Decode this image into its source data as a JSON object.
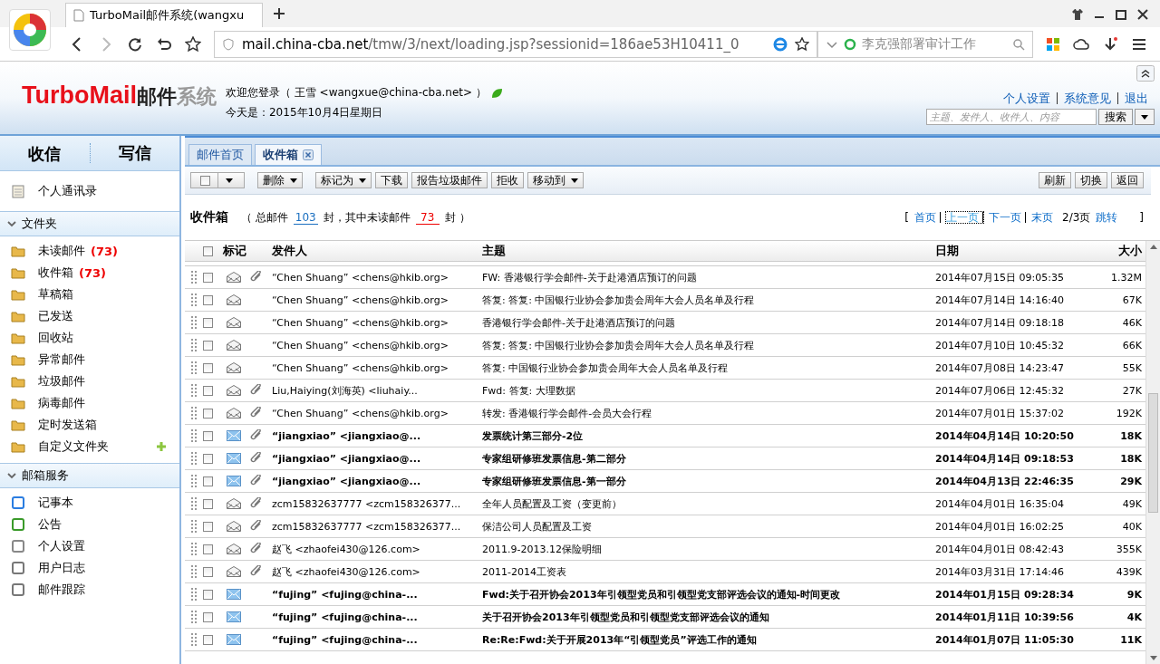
{
  "browser": {
    "tab_title": "TurboMail邮件系统(wangxu",
    "url_host": "mail.china-cba.net",
    "url_path": "/tmw/3/next/loading.jsp?sessionid=186ae53H10411_0",
    "search_value": "李克强部署审计工作"
  },
  "header": {
    "logo_brand": "TurboMail",
    "logo_mail": "邮件",
    "logo_system": "系统",
    "welcome": "欢迎您登录（ 王雪   <wangxue@china-cba.net> ）",
    "date": "今天是：2015年10月4日星期日",
    "links": [
      "个人设置",
      "系统意见",
      "退出"
    ],
    "search": {
      "placeholder": "主题、发件人、收件人、内容",
      "button": "搜索"
    }
  },
  "sidebar": {
    "tabs": [
      "收信",
      "写信"
    ],
    "contacts": "个人通讯录",
    "sections": [
      {
        "title": "文件夹",
        "expanded": true,
        "items": [
          {
            "label": "未读邮件",
            "count": "(73)",
            "add": false
          },
          {
            "label": "收件箱",
            "count": "(73)",
            "add": false
          },
          {
            "label": "草稿箱",
            "add": false
          },
          {
            "label": "已发送",
            "add": false
          },
          {
            "label": "回收站",
            "add": false
          },
          {
            "label": "异常邮件",
            "add": false
          },
          {
            "label": "垃圾邮件",
            "add": false
          },
          {
            "label": "病毒邮件",
            "add": false
          },
          {
            "label": "定时发送箱",
            "add": false
          },
          {
            "label": "自定义文件夹",
            "add": true
          }
        ]
      },
      {
        "title": "邮箱服务",
        "expanded": true,
        "items": [
          {
            "label": "记事本",
            "add": false
          },
          {
            "label": "公告",
            "add": false
          },
          {
            "label": "个人设置",
            "add": false
          },
          {
            "label": "用户日志",
            "add": false
          },
          {
            "label": "邮件跟踪",
            "add": false
          }
        ]
      }
    ]
  },
  "tabs": [
    {
      "label": "邮件首页",
      "selected": false,
      "closable": false
    },
    {
      "label": "收件箱",
      "selected": true,
      "closable": true
    }
  ],
  "toolbar": {
    "left": [
      {
        "label": "删除",
        "dropdown": true
      },
      {
        "label": "标记为",
        "dropdown": true
      },
      {
        "label": "下载",
        "dropdown": false
      },
      {
        "label": "报告垃圾邮件",
        "dropdown": false
      },
      {
        "label": "拒收",
        "dropdown": false
      },
      {
        "label": "移动到",
        "dropdown": true
      }
    ],
    "right": [
      "刷新",
      "切换",
      "返回"
    ]
  },
  "summary": {
    "folder": "收件箱",
    "total_prefix": "（ 总邮件",
    "total": "103",
    "middle": "封，其中未读邮件",
    "unread": "73",
    "suffix": "封 ）"
  },
  "pager": {
    "open": "[",
    "links": [
      {
        "label": "首页",
        "focused": false
      },
      {
        "label": "上一页",
        "focused": true
      },
      {
        "label": "下一页",
        "focused": false
      },
      {
        "label": "末页",
        "focused": false
      }
    ],
    "page": "2/3页",
    "jump": "跳转",
    "close": "]"
  },
  "columns": {
    "select_all_checked": false,
    "mark": "标记",
    "sender": "发件人",
    "subject": "主题",
    "date": "日期",
    "size": "大小"
  },
  "rows": [
    {
      "sender": "“Chen Shuang” <chens@hkib.org>",
      "subject": "FW: 香港银行学会邮件-关于赴港酒店预订的问题",
      "date": "2014年07月15日 09:05:35",
      "size": "1.32M",
      "unread": false,
      "attachment": true,
      "checked": false
    },
    {
      "sender": "“Chen Shuang” <chens@hkib.org>",
      "subject": "答复: 答复: 中国银行业协会参加贵会周年大会人员名单及行程",
      "date": "2014年07月14日 14:16:40",
      "size": "67K",
      "unread": false,
      "attachment": false,
      "checked": false
    },
    {
      "sender": "“Chen Shuang” <chens@hkib.org>",
      "subject": "香港银行学会邮件-关于赴港酒店预订的问题",
      "date": "2014年07月14日 09:18:18",
      "size": "46K",
      "unread": false,
      "attachment": false,
      "checked": false
    },
    {
      "sender": "“Chen Shuang” <chens@hkib.org>",
      "subject": "答复: 答复: 中国银行业协会参加贵会周年大会人员名单及行程",
      "date": "2014年07月10日 10:45:32",
      "size": "66K",
      "unread": false,
      "attachment": false,
      "checked": false
    },
    {
      "sender": "“Chen Shuang” <chens@hkib.org>",
      "subject": "答复: 中国银行业协会参加贵会周年大会人员名单及行程",
      "date": "2014年07月08日 14:23:47",
      "size": "55K",
      "unread": false,
      "attachment": false,
      "checked": false
    },
    {
      "sender": "Liu,Haiying(刘海英) <liuhaiy...",
      "subject": "Fwd: 答复: 大理数据",
      "date": "2014年07月06日 12:45:32",
      "size": "27K",
      "unread": false,
      "attachment": true,
      "checked": false
    },
    {
      "sender": "“Chen Shuang” <chens@hkib.org>",
      "subject": "转发:  香港银行学会邮件-会员大会行程",
      "date": "2014年07月01日 15:37:02",
      "size": "192K",
      "unread": false,
      "attachment": true,
      "checked": false
    },
    {
      "sender": "“jiangxiao” <jiangxiao@...",
      "subject": "发票统计第三部分-2位",
      "date": "2014年04月14日 10:20:50",
      "size": "18K",
      "unread": true,
      "attachment": true,
      "checked": false
    },
    {
      "sender": "“jiangxiao” <jiangxiao@...",
      "subject": "专家组研修班发票信息-第二部分",
      "date": "2014年04月14日 09:18:53",
      "size": "18K",
      "unread": true,
      "attachment": true,
      "checked": false
    },
    {
      "sender": "“jiangxiao” <jiangxiao@...",
      "subject": "专家组研修班发票信息-第一部分",
      "date": "2014年04月13日 22:46:35",
      "size": "29K",
      "unread": true,
      "attachment": true,
      "checked": false
    },
    {
      "sender": "zcm15832637777 <zcm158326377...",
      "subject": "全年人员配置及工资（变更前）",
      "date": "2014年04月01日 16:35:04",
      "size": "49K",
      "unread": false,
      "attachment": true,
      "checked": false
    },
    {
      "sender": "zcm15832637777 <zcm158326377...",
      "subject": "保洁公司人员配置及工资",
      "date": "2014年04月01日 16:02:25",
      "size": "40K",
      "unread": false,
      "attachment": true,
      "checked": false
    },
    {
      "sender": "赵飞 <zhaofei430@126.com>",
      "subject": "2011.9-2013.12保险明细",
      "date": "2014年04月01日 08:42:43",
      "size": "355K",
      "unread": false,
      "attachment": true,
      "checked": false
    },
    {
      "sender": "赵飞 <zhaofei430@126.com>",
      "subject": "2011-2014工资表",
      "date": "2014年03月31日 17:14:46",
      "size": "439K",
      "unread": false,
      "attachment": true,
      "checked": false
    },
    {
      "sender": "“fujing” <fujing@china-...",
      "subject": "Fwd:关于召开协会2013年引领型党员和引领型党支部评选会议的通知-时间更改",
      "date": "2014年01月15日 09:28:34",
      "size": "9K",
      "unread": true,
      "attachment": false,
      "checked": false
    },
    {
      "sender": "“fujing” <fujing@china-...",
      "subject": "关于召开协会2013年引领型党员和引领型党支部评选会议的通知",
      "date": "2014年01月11日 10:39:56",
      "size": "4K",
      "unread": true,
      "attachment": false,
      "checked": false
    },
    {
      "sender": "“fujing” <fujing@china-...",
      "subject": "Re:Re:Fwd:关于开展2013年“引领型党员”评选工作的通知",
      "date": "2014年01月07日 11:05:30",
      "size": "11K",
      "unread": true,
      "attachment": false,
      "checked": false
    }
  ]
}
